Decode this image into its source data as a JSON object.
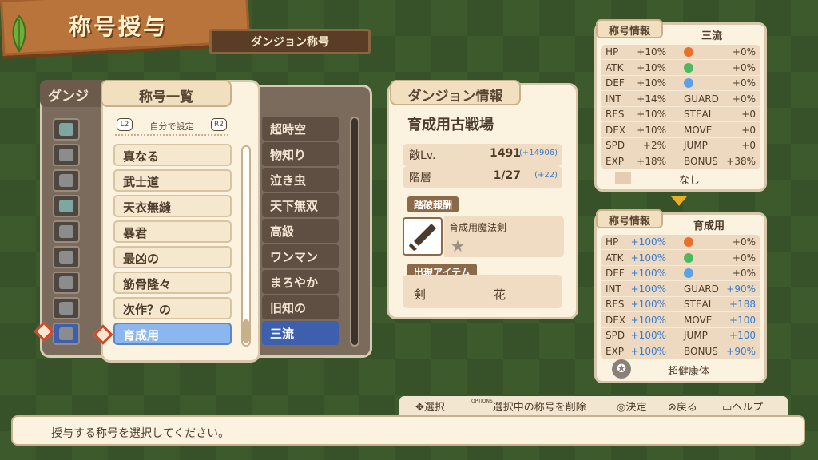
{
  "header": {
    "title": "称号授与",
    "subtitle": "ダンジョン称号"
  },
  "dungeon_panel": {
    "label": "ダンジ",
    "titles": [
      "超時空",
      "物知り",
      "泣き虫",
      "天下無双",
      "高級",
      "ワンマン",
      "まろやか",
      "旧知の",
      "三流"
    ],
    "selected_index": 8
  },
  "title_list": {
    "header": "称号一覧",
    "mode_label": "自分で設定",
    "l_button": "L2",
    "r_button": "R2",
    "items": [
      "真なる",
      "武士道",
      "天衣無縫",
      "暴君",
      "最凶の",
      "筋骨隆々",
      "次作？の",
      "育成用"
    ],
    "selected_index": 7
  },
  "dungeon_info": {
    "header": "ダンジョン情報",
    "name": "育成用古戦場",
    "enemy_level_label": "敵Lv.",
    "enemy_level_value": "1491",
    "enemy_level_bonus": "(+14906)",
    "floor_label": "階層",
    "floor_value": "1/27",
    "floor_bonus": "(+22)",
    "reward_tag": "踏破報酬",
    "reward_name": "育成用魔法剣",
    "items_tag": "出現アイテム",
    "items": [
      "剣",
      "花"
    ]
  },
  "stats_current": {
    "header": "称号情報",
    "name": "三流",
    "rows": [
      {
        "k": "HP",
        "v": "+10%",
        "k2": "",
        "v2": "+0%",
        "icon": "fire"
      },
      {
        "k": "ATK",
        "v": "+10%",
        "k2": "",
        "v2": "+0%",
        "icon": "wind"
      },
      {
        "k": "DEF",
        "v": "+10%",
        "k2": "",
        "v2": "+0%",
        "icon": "ice"
      },
      {
        "k": "INT",
        "v": "+14%",
        "k2": "GUARD",
        "v2": "+0%"
      },
      {
        "k": "RES",
        "v": "+10%",
        "k2": "STEAL",
        "v2": "+0"
      },
      {
        "k": "DEX",
        "v": "+10%",
        "k2": "MOVE",
        "v2": "+0"
      },
      {
        "k": "SPD",
        "v": "+2%",
        "k2": "JUMP",
        "v2": "+0"
      },
      {
        "k": "EXP",
        "v": "+18%",
        "k2": "BONUS",
        "v2": "+38%"
      }
    ],
    "skill": "なし"
  },
  "stats_new": {
    "header": "称号情報",
    "name": "育成用",
    "rows": [
      {
        "k": "HP",
        "v": "+100%",
        "k2": "",
        "v2": "+0%",
        "icon": "fire"
      },
      {
        "k": "ATK",
        "v": "+100%",
        "k2": "",
        "v2": "+0%",
        "icon": "wind"
      },
      {
        "k": "DEF",
        "v": "+100%",
        "k2": "",
        "v2": "+0%",
        "icon": "ice"
      },
      {
        "k": "INT",
        "v": "+100%",
        "k2": "GUARD",
        "v2": "+90%"
      },
      {
        "k": "RES",
        "v": "+100%",
        "k2": "STEAL",
        "v2": "+188"
      },
      {
        "k": "DEX",
        "v": "+100%",
        "k2": "MOVE",
        "v2": "+100"
      },
      {
        "k": "SPD",
        "v": "+100%",
        "k2": "JUMP",
        "v2": "+100"
      },
      {
        "k": "EXP",
        "v": "+100%",
        "k2": "BONUS",
        "v2": "+90%"
      }
    ],
    "skill": "超健康体"
  },
  "controls": {
    "select": "選択",
    "options_label": "OPTIONS",
    "delete": "選択中の称号を削除",
    "confirm": "決定",
    "back": "戻る",
    "help": "ヘルプ"
  },
  "message": "授与する称号を選択してください。",
  "colors": {
    "accent_blue": "#3a7ad1",
    "selected_row": "#3d5fae",
    "cursor_red": "#d8442a"
  }
}
